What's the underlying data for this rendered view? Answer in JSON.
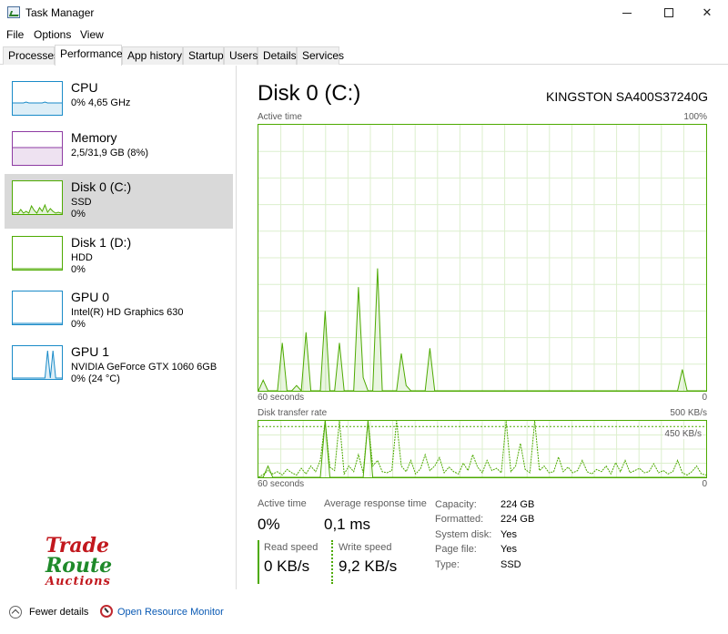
{
  "window": {
    "title": "Task Manager"
  },
  "menu": [
    "File",
    "Options",
    "View"
  ],
  "tabs": [
    {
      "label": "Processes",
      "active": false
    },
    {
      "label": "Performance",
      "active": true
    },
    {
      "label": "App history",
      "active": false
    },
    {
      "label": "Startup",
      "active": false
    },
    {
      "label": "Users",
      "active": false
    },
    {
      "label": "Details",
      "active": false
    },
    {
      "label": "Services",
      "active": false
    }
  ],
  "resources": [
    {
      "title": "CPU",
      "line1": "0%  4,65 GHz",
      "line2": "",
      "color": "#1a8bc8",
      "selected": false
    },
    {
      "title": "Memory",
      "line1": "2,5/31,9 GB (8%)",
      "line2": "",
      "color": "#8e3ba3",
      "selected": false
    },
    {
      "title": "Disk 0 (C:)",
      "line1": "SSD",
      "line2": "0%",
      "color": "#4daa00",
      "selected": true
    },
    {
      "title": "Disk 1 (D:)",
      "line1": "HDD",
      "line2": "0%",
      "color": "#4daa00",
      "selected": false
    },
    {
      "title": "GPU 0",
      "line1": "Intel(R) HD Graphics 630",
      "line2": "0%",
      "color": "#1a8bc8",
      "selected": false
    },
    {
      "title": "GPU 1",
      "line1": "NVIDIA GeForce GTX 1060 6GB",
      "line2": "0%  (24 °C)",
      "color": "#1a8bc8",
      "selected": false
    }
  ],
  "logo": {
    "trade": "Trade",
    "route": "Route",
    "auctions": "Auctions"
  },
  "detail": {
    "title": "Disk 0 (C:)",
    "model": "KINGSTON SA400S37240G",
    "active_graph": {
      "label": "Active time",
      "max_label": "100%",
      "time_label": "60 seconds",
      "min_label": "0",
      "values": [
        0,
        4,
        0,
        0,
        0,
        18,
        0,
        0,
        2,
        0,
        22,
        0,
        0,
        0,
        30,
        0,
        0,
        18,
        0,
        0,
        0,
        39,
        5,
        0,
        0,
        46,
        0,
        0,
        0,
        0,
        14,
        2,
        0,
        0,
        0,
        0,
        16,
        0,
        0,
        0,
        0,
        0,
        0,
        0,
        0,
        0,
        0,
        0,
        0,
        0,
        0,
        0,
        0,
        0,
        0,
        0,
        0,
        0,
        0,
        0,
        0,
        0,
        0,
        0,
        0,
        0,
        0,
        0,
        0,
        0,
        0,
        0,
        0,
        0,
        0,
        0,
        0,
        0,
        0,
        0,
        0,
        0,
        0,
        0,
        0,
        0,
        0,
        0,
        0,
        8,
        0,
        0,
        0,
        0,
        0
      ]
    },
    "transfer_graph": {
      "label": "Disk transfer rate",
      "max_label": "500 KB/s",
      "ref_label": "450 KB/s",
      "time_label": "60 seconds",
      "min_label": "0",
      "read_values": [
        0,
        0,
        20,
        0,
        0,
        0,
        0,
        0,
        0,
        0,
        0,
        0,
        0,
        0,
        100,
        0,
        0,
        0,
        0,
        0,
        0,
        0,
        0,
        100,
        0,
        0,
        0,
        0,
        0,
        0,
        0,
        0,
        0,
        0,
        0,
        0,
        0,
        0,
        0,
        0,
        0,
        0,
        0,
        0,
        0,
        0,
        0,
        0,
        0,
        0,
        0,
        0,
        0,
        0,
        0,
        0,
        0,
        0,
        0,
        0,
        0,
        0,
        0,
        0,
        0,
        0,
        0,
        0,
        0,
        0,
        0,
        0,
        0,
        0,
        0,
        0,
        0,
        0,
        0,
        0,
        0,
        0,
        0,
        0,
        0,
        0,
        0,
        0,
        0,
        0,
        0,
        0,
        0,
        0,
        0
      ],
      "write_values": [
        0,
        5,
        12,
        6,
        10,
        4,
        14,
        8,
        4,
        16,
        6,
        20,
        10,
        30,
        100,
        18,
        12,
        100,
        6,
        20,
        10,
        40,
        8,
        100,
        20,
        30,
        10,
        8,
        12,
        100,
        20,
        10,
        30,
        6,
        15,
        40,
        12,
        20,
        35,
        8,
        18,
        10,
        6,
        25,
        12,
        40,
        18,
        8,
        30,
        12,
        16,
        8,
        100,
        10,
        20,
        60,
        14,
        8,
        100,
        12,
        20,
        8,
        10,
        36,
        10,
        18,
        8,
        12,
        30,
        10,
        6,
        14,
        10,
        20,
        6,
        26,
        10,
        30,
        8,
        12,
        16,
        8,
        10,
        24,
        8,
        12,
        6,
        10,
        30,
        8,
        4,
        10,
        20,
        6,
        4
      ]
    },
    "stats": {
      "active_time_label": "Active time",
      "active_time_value": "0%",
      "response_label": "Average response time",
      "response_value": "0,1 ms",
      "read_label": "Read speed",
      "read_value": "0 KB/s",
      "write_label": "Write speed",
      "write_value": "9,2 KB/s"
    },
    "properties": [
      {
        "key": "Capacity:",
        "value": "224 GB"
      },
      {
        "key": "Formatted:",
        "value": "224 GB"
      },
      {
        "key": "System disk:",
        "value": "Yes"
      },
      {
        "key": "Page file:",
        "value": "Yes"
      },
      {
        "key": "Type:",
        "value": "SSD"
      }
    ]
  },
  "footer": {
    "fewer_details": "Fewer details",
    "open_monitor": "Open Resource Monitor"
  },
  "colors": {
    "disk": "#4daa00",
    "cpu": "#1a8bc8",
    "memory": "#8e3ba3",
    "selected_bg": "#d9d9d9"
  }
}
